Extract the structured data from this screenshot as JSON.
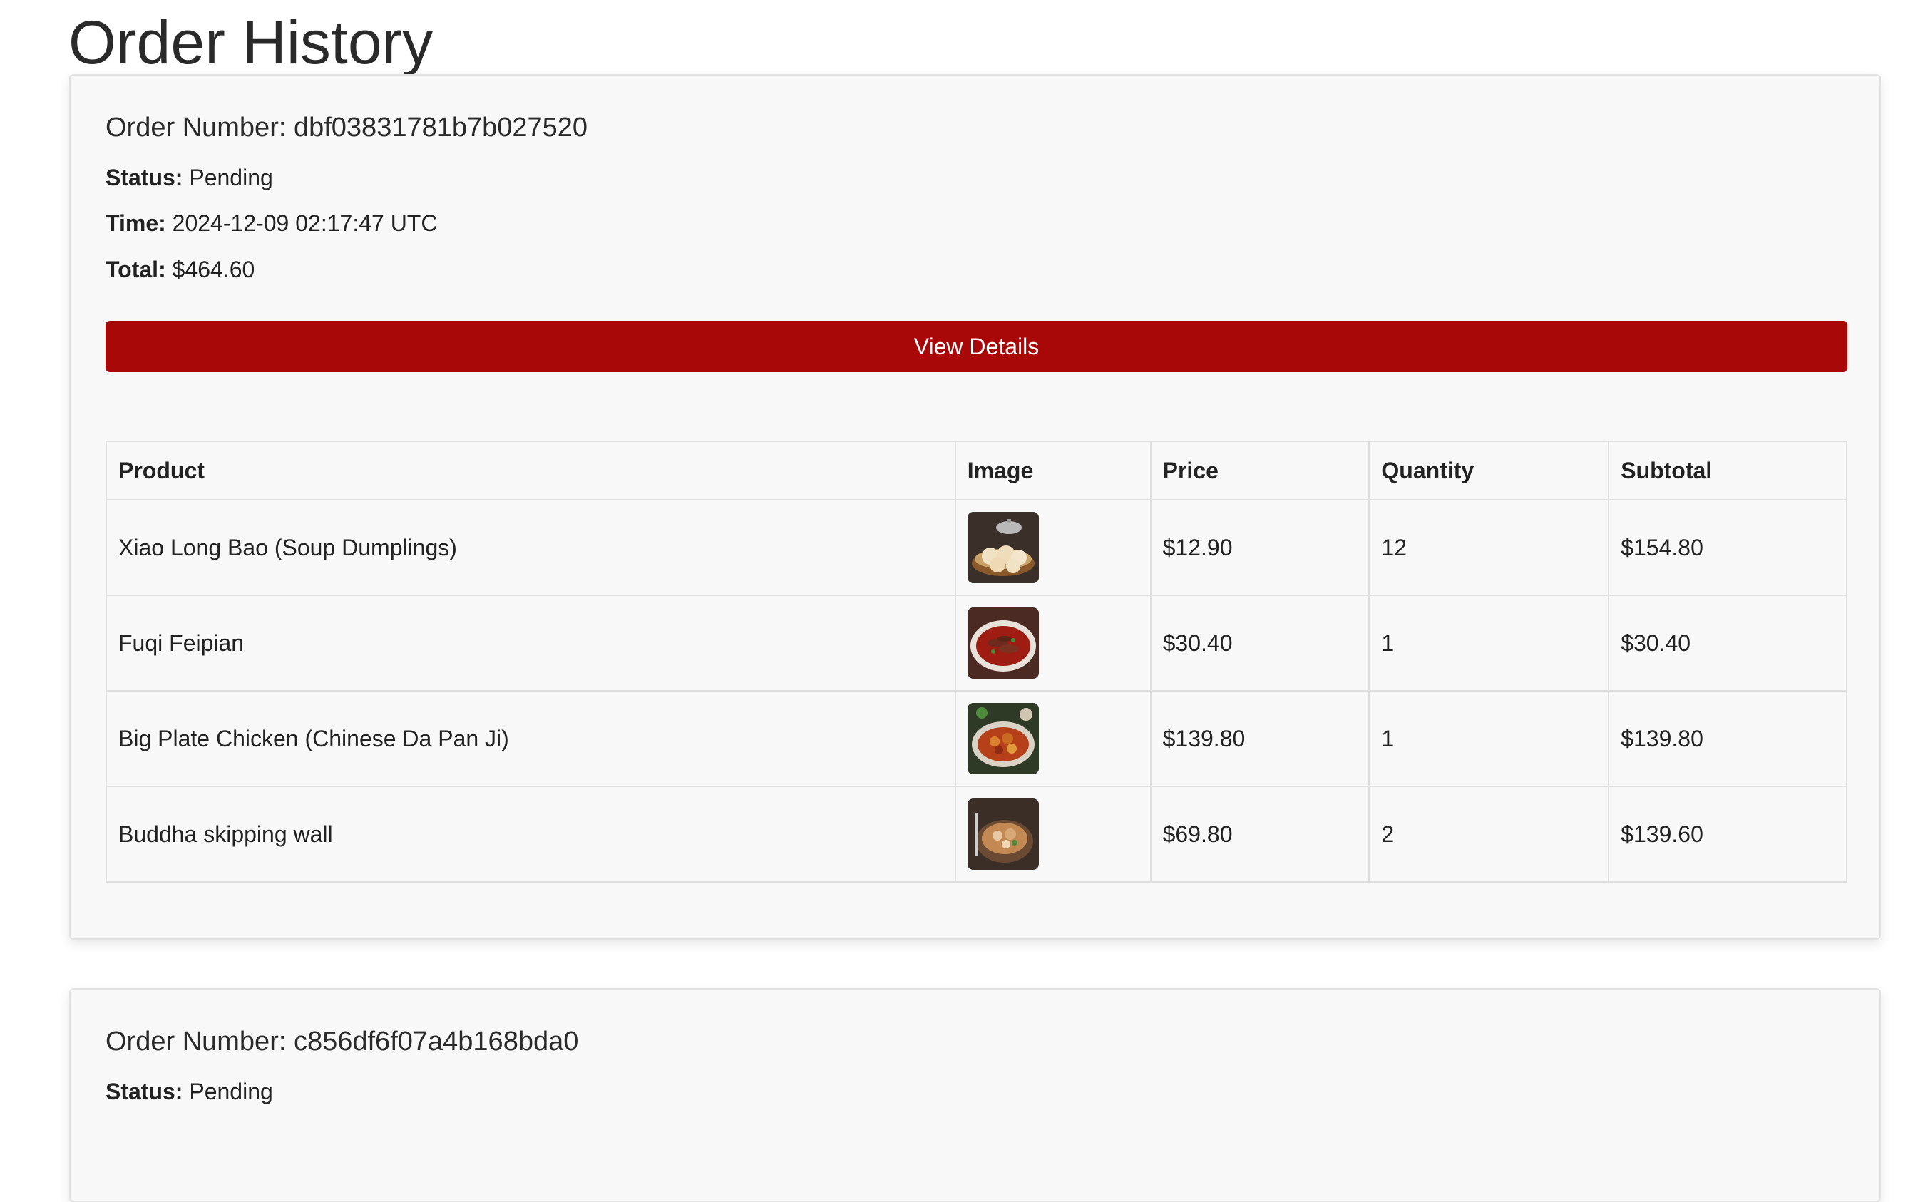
{
  "page": {
    "title": "Order History"
  },
  "labels": {
    "order_number": "Order Number:",
    "status": "Status:",
    "time": "Time:",
    "total": "Total:",
    "view_details": "View Details"
  },
  "table_headers": {
    "product": "Product",
    "image": "Image",
    "price": "Price",
    "quantity": "Quantity",
    "subtotal": "Subtotal"
  },
  "orders": [
    {
      "number": "dbf03831781b7b027520",
      "status": "Pending",
      "time": "2024-12-09 02:17:47 UTC",
      "total": "$464.60",
      "items": [
        {
          "product": "Xiao Long Bao (Soup Dumplings)",
          "image": "soup-dumplings-photo",
          "price": "$12.90",
          "quantity": "12",
          "subtotal": "$154.80"
        },
        {
          "product": "Fuqi Feipian",
          "image": "fuqi-feipian-photo",
          "price": "$30.40",
          "quantity": "1",
          "subtotal": "$30.40"
        },
        {
          "product": "Big Plate Chicken (Chinese Da Pan Ji)",
          "image": "big-plate-chicken-photo",
          "price": "$139.80",
          "quantity": "1",
          "subtotal": "$139.80"
        },
        {
          "product": "Buddha skipping wall",
          "image": "buddha-jumps-wall-photo",
          "price": "$69.80",
          "quantity": "2",
          "subtotal": "$139.60"
        }
      ]
    },
    {
      "number": "c856df6f07a4b168bda0",
      "status": "Pending"
    }
  ],
  "colors": {
    "accent": "#a80808",
    "card_bg": "#f8f8f8",
    "border": "#dedede"
  }
}
